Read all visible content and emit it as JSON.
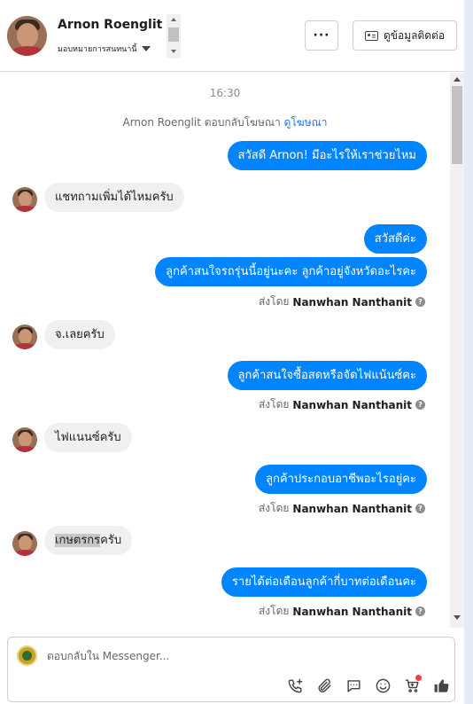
{
  "header": {
    "contact_name": "Arnon Roenglit",
    "assign_label": "มอบหมายการสนทนานี้",
    "more_label": "···",
    "contact_info_label": "ดูข้อมูลติดต่อ"
  },
  "thread": {
    "timestamp": "16:30",
    "system_text": "Arnon Roenglit ตอบกลับโฆษณา",
    "system_link": "ดูโฆษณา",
    "sent_by_prefix": "ส่งโดย",
    "sender_name": "Nanwhan Nanthanit",
    "messages": [
      {
        "dir": "out",
        "text": "สวัสดี Arnon! มีอะไรให้เราช่วยไหม"
      },
      {
        "dir": "in",
        "text": "แชทถามเพิ่มได้ไหมครับ"
      },
      {
        "dir": "out",
        "text": "สวัสดีค่ะ"
      },
      {
        "dir": "out",
        "text": "ลูกค้าสนใจรถรุ่นนี้อยู่นะคะ ลูกค้าอยู่จังหวัดอะไรคะ"
      },
      {
        "dir": "in",
        "text": "จ.เลยครับ"
      },
      {
        "dir": "out",
        "text": "ลูกค้าสนใจซื้อสดหรือจัดไฟแน้นซ์คะ"
      },
      {
        "dir": "in",
        "text": "ไฟแนนซ์ครับ"
      },
      {
        "dir": "out",
        "text": "ลูกค้าประกอบอาชีพอะไรอยู่คะ"
      },
      {
        "dir": "in",
        "text": "เกษตรกรครับ",
        "highlight": "เกษตรกร",
        "rest": "ครับ"
      },
      {
        "dir": "out",
        "text": "รายได้ต่อเดือนลูกค้ากี่บาทต่อเดือนคะ"
      }
    ]
  },
  "composer": {
    "placeholder": "ตอบกลับใน Messenger...",
    "tools": [
      "call-add-icon",
      "attachment-icon",
      "saved-reply-icon",
      "emoji-icon",
      "cart-icon",
      "like-icon"
    ]
  },
  "colors": {
    "outgoing_bubble": "#0084ff",
    "incoming_bubble": "#f0f0f0",
    "link": "#1877f2",
    "notification_dot": "#fa3e3e"
  }
}
